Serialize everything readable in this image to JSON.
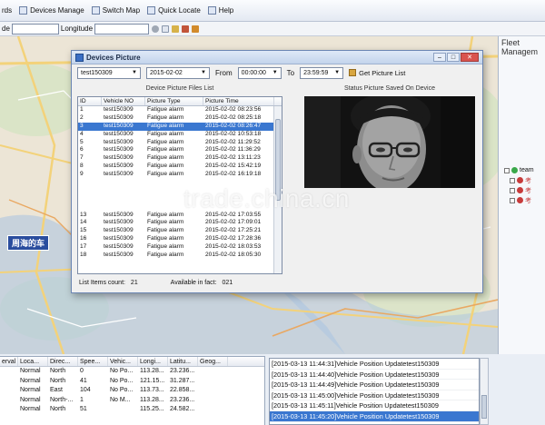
{
  "menubar": {
    "items": [
      {
        "label": "rds"
      },
      {
        "label": "Devices Manage"
      },
      {
        "label": "Switch Map"
      },
      {
        "label": "Quick Locate"
      },
      {
        "label": "Help"
      }
    ]
  },
  "coordbar": {
    "latitude_label": "de",
    "longitude_label": "Longitude"
  },
  "map": {
    "vehicle_label": "周海的车"
  },
  "rightpanel": {
    "title": "Fleet Managem",
    "tree": [
      {
        "label": "team"
      },
      {
        "label": "考"
      },
      {
        "label": "考"
      },
      {
        "label": "考"
      }
    ]
  },
  "dialog": {
    "title": "Devices Picture",
    "device_select": "test150309",
    "date_select": "2015-02-02",
    "from_label": "From",
    "from_time": "00:00:00",
    "to_label": "To",
    "to_time": "23:59:59",
    "get_button": "Get Picture List",
    "list_title": "Device Picture Files List",
    "picture_title": "Status Picture Saved On Device",
    "columns": [
      "ID",
      "Vehicle NO",
      "Picture Type",
      "Picture Time"
    ],
    "rows": [
      {
        "id": "1",
        "veh": "test150309",
        "type": "Fatigue alarm",
        "time": "2015-02-02 08:23:56"
      },
      {
        "id": "2",
        "veh": "test150309",
        "type": "Fatigue alarm",
        "time": "2015-02-02 08:25:18"
      },
      {
        "id": "3",
        "veh": "test150309",
        "type": "Fatigue alarm",
        "time": "2015-02-02 08:26:47"
      },
      {
        "id": "4",
        "veh": "test150309",
        "type": "Fatigue alarm",
        "time": "2015-02-02 10:53:18"
      },
      {
        "id": "5",
        "veh": "test150309",
        "type": "Fatigue alarm",
        "time": "2015-02-02 11:29:52"
      },
      {
        "id": "6",
        "veh": "test150309",
        "type": "Fatigue alarm",
        "time": "2015-02-02 11:36:29"
      },
      {
        "id": "7",
        "veh": "test150309",
        "type": "Fatigue alarm",
        "time": "2015-02-02 13:11:23"
      },
      {
        "id": "8",
        "veh": "test150309",
        "type": "Fatigue alarm",
        "time": "2015-02-02 15:42:19"
      },
      {
        "id": "9",
        "veh": "test150309",
        "type": "Fatigue alarm",
        "time": "2015-02-02 16:19:18"
      },
      {
        "id": "",
        "veh": "",
        "type": "",
        "time": ""
      },
      {
        "id": "",
        "veh": "",
        "type": "",
        "time": ""
      },
      {
        "id": "",
        "veh": "",
        "type": "",
        "time": ""
      },
      {
        "id": "",
        "veh": "",
        "type": "",
        "time": ""
      },
      {
        "id": "13",
        "veh": "test150309",
        "type": "Fatigue alarm",
        "time": "2015-02-02 17:03:55"
      },
      {
        "id": "14",
        "veh": "test150309",
        "type": "Fatigue alarm",
        "time": "2015-02-02 17:09:01"
      },
      {
        "id": "15",
        "veh": "test150309",
        "type": "Fatigue alarm",
        "time": "2015-02-02 17:25:21"
      },
      {
        "id": "16",
        "veh": "test150309",
        "type": "Fatigue alarm",
        "time": "2015-02-02 17:28:36"
      },
      {
        "id": "17",
        "veh": "test150309",
        "type": "Fatigue alarm",
        "time": "2015-02-02 18:03:53"
      },
      {
        "id": "18",
        "veh": "test150309",
        "type": "Fatigue alarm",
        "time": "2015-02-02 18:05:30"
      },
      {
        "id": "",
        "veh": "",
        "type": "",
        "time": ""
      },
      {
        "id": "",
        "veh": "",
        "type": "",
        "time": ""
      }
    ],
    "selected_index": 2,
    "list_count_label": "List Items count:",
    "list_count": "21",
    "available_label": "Available in fact:",
    "available_count": "021"
  },
  "watermark": "trade.china.cn",
  "vehicle_table": {
    "columns": [
      "erval",
      "Loca...",
      "Direc...",
      "Spee...",
      "Vehic...",
      "Longi...",
      "Latitu...",
      "Geog..."
    ],
    "rows": [
      [
        "",
        "Normal",
        "North",
        "0",
        "No Po...",
        "113.28...",
        "23.236...",
        ""
      ],
      [
        "",
        "Normal",
        "North",
        "41",
        "No Po...",
        "121.15...",
        "31.287...",
        ""
      ],
      [
        "",
        "Normal",
        "East",
        "104",
        "No Po...",
        "113.73...",
        "22.858...",
        ""
      ],
      [
        "",
        "Normal",
        "North-...",
        "1",
        "No M...",
        "113.28...",
        "23.236...",
        ""
      ],
      [
        "",
        "Normal",
        "North",
        "51",
        "",
        "115.25...",
        "24.582...",
        ""
      ]
    ]
  },
  "log": {
    "rows": [
      "[2015-03-13 11:44:31]Vehicle Position Updatetest150309",
      "[2015-03-13 11:44:40]Vehicle Position Updatetest150309",
      "[2015-03-13 11:44:49]Vehicle Position Updatetest150309",
      "[2015-03-13 11:45:00]Vehicle Position Updatetest150309",
      "[2015-03-13 11:45:11]Vehicle Position Updatetest150309",
      "[2015-03-13 11:45:20]Vehicle Position Updatetest150309"
    ],
    "selected_index": 5
  },
  "colors": {
    "selection": "#3a77d0",
    "map_bg": "#ece5d6",
    "water": "#a9c3e2",
    "road": "#f3d27a"
  }
}
